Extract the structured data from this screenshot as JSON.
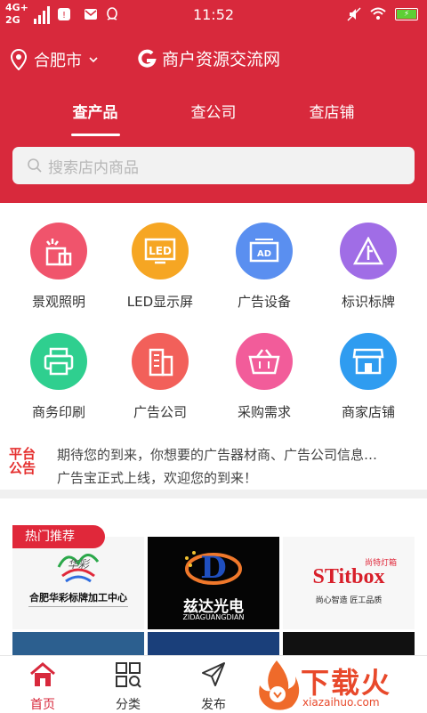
{
  "status_bar": {
    "network_top": "4G+",
    "network_bottom": "2G",
    "time": "11:52"
  },
  "header": {
    "location": "合肥市",
    "brand_name": "商户资源交流网",
    "tabs": [
      {
        "label": "查产品",
        "active": true
      },
      {
        "label": "查公司",
        "active": false
      },
      {
        "label": "查店铺",
        "active": false
      }
    ],
    "search_placeholder": "搜索店内商品"
  },
  "categories": [
    {
      "label": "景观照明",
      "icon": "building-lights-icon",
      "color": "#f0546c"
    },
    {
      "label": "LED显示屏",
      "icon": "led-screen-icon",
      "color": "#f6a623"
    },
    {
      "label": "广告设备",
      "icon": "ad-board-icon",
      "color": "#5a8ff0"
    },
    {
      "label": "标识标牌",
      "icon": "sign-triangle-icon",
      "color": "#a06de6"
    },
    {
      "label": "商务印刷",
      "icon": "printer-icon",
      "color": "#2fcf8f"
    },
    {
      "label": "广告公司",
      "icon": "office-building-icon",
      "color": "#f2605a"
    },
    {
      "label": "采购需求",
      "icon": "basket-icon",
      "color": "#f25c9a"
    },
    {
      "label": "商家店铺",
      "icon": "storefront-icon",
      "color": "#2f9cf0"
    }
  ],
  "notice": {
    "badge_line1": "平台",
    "badge_line2": "公告",
    "line1": "期待您的到来，你想要的广告器材商、广告公司信息…",
    "line2": "广告宝正式上线，欢迎您的到来！"
  },
  "hot": {
    "badge": "热门推荐",
    "tiles": [
      {
        "title": "合肥华彩标牌加工中心",
        "sub": "华彩"
      },
      {
        "title": "兹达光电",
        "sub": "ZIDAGUANGDIAN"
      },
      {
        "title": "STitbox",
        "sub": "尚心智造 匠工品质",
        "tag": "尚特灯箱"
      }
    ]
  },
  "tabbar": [
    {
      "label": "首页",
      "icon": "home-icon",
      "active": true
    },
    {
      "label": "分类",
      "icon": "category-icon",
      "active": false
    },
    {
      "label": "发布",
      "icon": "send-icon",
      "active": false
    }
  ],
  "watermark": {
    "text": "下载火",
    "url": "xiazaihuo.com"
  },
  "colors": {
    "brand_red": "#d8293c",
    "hot_red": "#e0283a"
  }
}
